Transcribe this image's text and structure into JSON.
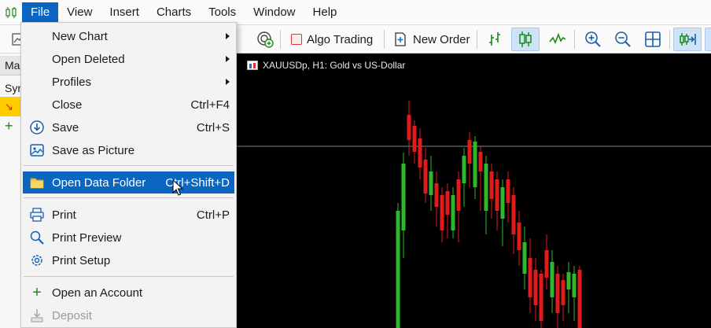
{
  "menubar": {
    "items": [
      {
        "label": "File",
        "active": true
      },
      {
        "label": "View"
      },
      {
        "label": "Insert"
      },
      {
        "label": "Charts"
      },
      {
        "label": "Tools"
      },
      {
        "label": "Window"
      },
      {
        "label": "Help"
      }
    ]
  },
  "toolbar": {
    "algo_trading": "Algo Trading",
    "new_order": "New Order"
  },
  "left_panel": {
    "tab_label": "Mar",
    "column_label": "Syr"
  },
  "chart": {
    "title": "XAUUSDp, H1:  Gold vs US-Dollar",
    "background": "#000000",
    "bull_color": "#2eb82e",
    "bear_color": "#e01b1b"
  },
  "file_menu": {
    "new_chart": "New Chart",
    "open_deleted": "Open Deleted",
    "profiles": "Profiles",
    "close": "Close",
    "close_shortcut": "Ctrl+F4",
    "save": "Save",
    "save_shortcut": "Ctrl+S",
    "save_as_picture": "Save as Picture",
    "open_data_folder": "Open Data Folder",
    "open_data_folder_shortcut": "Ctrl+Shift+D",
    "print": "Print",
    "print_shortcut": "Ctrl+P",
    "print_preview": "Print Preview",
    "print_setup": "Print Setup",
    "open_account": "Open an Account",
    "deposit": "Deposit"
  },
  "accent_color": "#0a66c2"
}
